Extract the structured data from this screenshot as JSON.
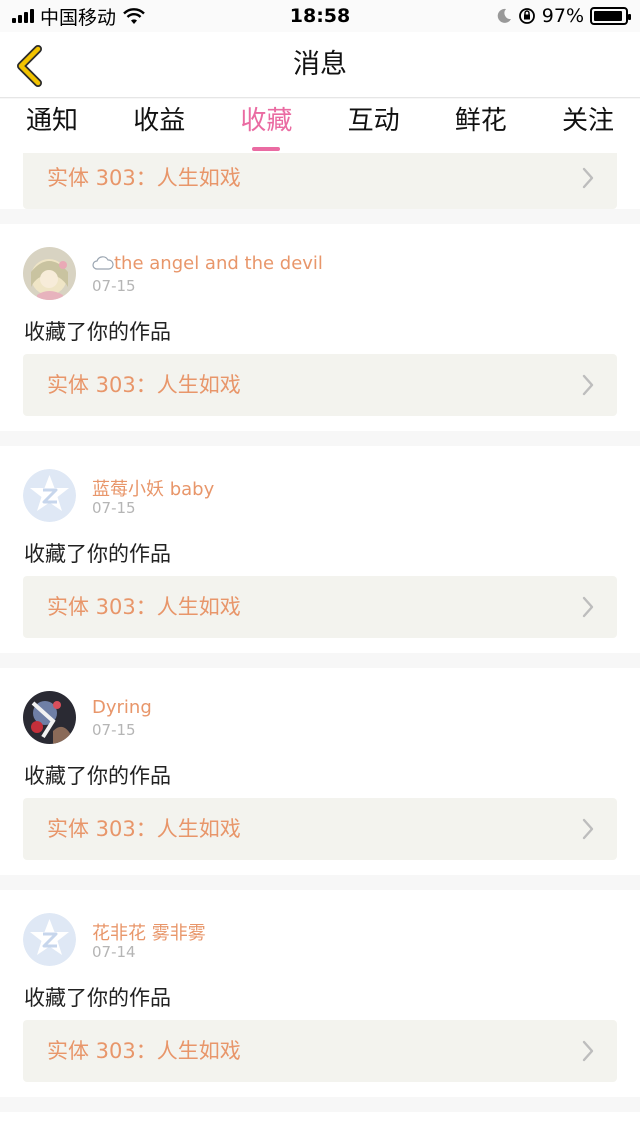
{
  "status_bar": {
    "carrier": "中国移动",
    "time": "18:58",
    "battery": "97%"
  },
  "nav": {
    "title": "消息"
  },
  "tabs": [
    {
      "label": "通知",
      "active": false
    },
    {
      "label": "收益",
      "active": false
    },
    {
      "label": "收藏",
      "active": true
    },
    {
      "label": "互动",
      "active": false
    },
    {
      "label": "鲜花",
      "active": false
    },
    {
      "label": "关注",
      "active": false
    }
  ],
  "partial_item": {
    "work_title": "实体 303：人生如戏"
  },
  "items": [
    {
      "username": "the angel and the devil",
      "username_prefix_icon": "cloud-icon",
      "date": "07-15",
      "action": "收藏了你的作品",
      "work_title": "实体 303：人生如戏",
      "avatar": "anime-girl-avatar"
    },
    {
      "username": "蓝莓小妖 baby",
      "date": "07-15",
      "action": "收藏了你的作品",
      "work_title": "实体 303：人生如戏",
      "avatar": "default-avatar"
    },
    {
      "username": "Dyring",
      "date": "07-15",
      "action": "收藏了你的作品",
      "work_title": "实体 303：人生如戏",
      "avatar": "dark-art-avatar"
    },
    {
      "username": "花非花 雾非雾",
      "date": "07-14",
      "action": "收藏了你的作品",
      "work_title": "实体 303：人生如戏",
      "avatar": "default-avatar"
    }
  ],
  "colors": {
    "accent": "#ea6ba2",
    "username": "#e8966a",
    "work_box_bg": "#f3f3ee",
    "back_arrow": "#f2c300"
  }
}
